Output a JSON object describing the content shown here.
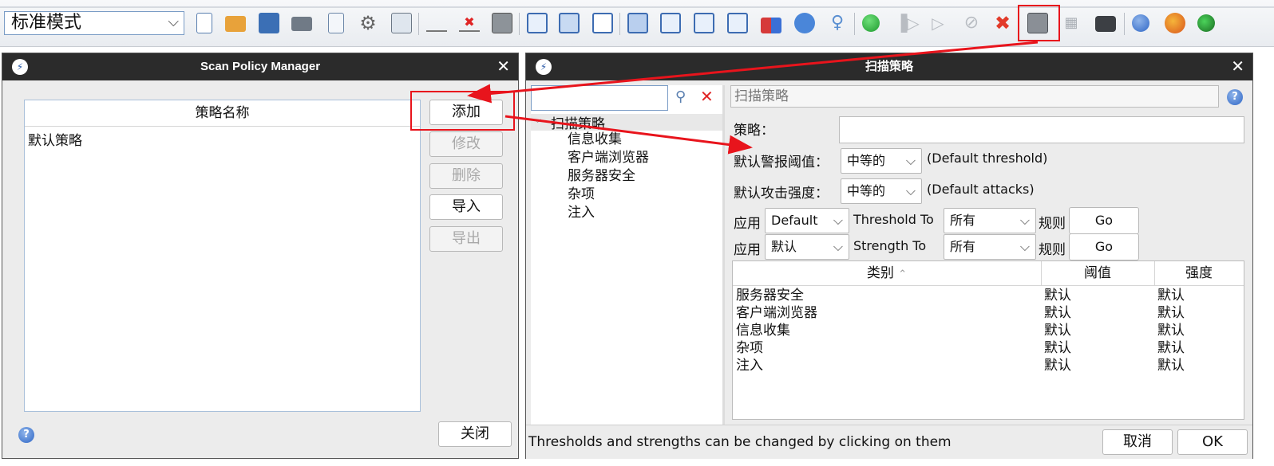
{
  "toolbar": {
    "mode_select": {
      "value": "标准模式"
    }
  },
  "scan_policy_manager": {
    "title": "Scan Policy Manager",
    "column_header": "策略名称",
    "policies": [
      "默认策略"
    ],
    "buttons": {
      "add": "添加",
      "modify": "修改",
      "delete": "删除",
      "import": "导入",
      "export": "导出",
      "close": "关闭"
    },
    "help_glyph": "?"
  },
  "scan_policy_dialog": {
    "title": "扫描策略",
    "search": {
      "value": ""
    },
    "tree": {
      "root": "扫描策略",
      "children": [
        "信息收集",
        "客户端浏览器",
        "服务器安全",
        "杂项",
        "注入"
      ]
    },
    "header_field": "扫描策略",
    "policy_label": "策略：",
    "policy_value": "",
    "default_threshold": {
      "label": "默认警报阈值：",
      "value": "中等的",
      "hint": "(Default threshold)"
    },
    "default_strength": {
      "label": "默认攻击强度：",
      "value": "中等的",
      "hint": "(Default attacks)"
    },
    "apply_threshold": {
      "apply": "应用",
      "value": "Default",
      "to": "Threshold To",
      "scope": "所有",
      "rule": "规则",
      "go": "Go"
    },
    "apply_strength": {
      "apply": "应用",
      "value": "默认",
      "to": "Strength To",
      "scope": "所有",
      "rule": "规则",
      "go": "Go"
    },
    "table": {
      "columns": [
        "类别",
        "阈值",
        "强度"
      ],
      "rows": [
        [
          "服务器安全",
          "默认",
          "默认"
        ],
        [
          "客户端浏览器",
          "默认",
          "默认"
        ],
        [
          "信息收集",
          "默认",
          "默认"
        ],
        [
          "杂项",
          "默认",
          "默认"
        ],
        [
          "注入",
          "默认",
          "默认"
        ]
      ]
    },
    "footer_hint": "Thresholds and strengths can be changed by clicking on them",
    "buttons": {
      "cancel": "取消",
      "ok": "OK"
    }
  },
  "colors": {
    "annotation": "#e8141c",
    "titlebar": "#2b2b2b",
    "accent": "#2f67c6"
  }
}
